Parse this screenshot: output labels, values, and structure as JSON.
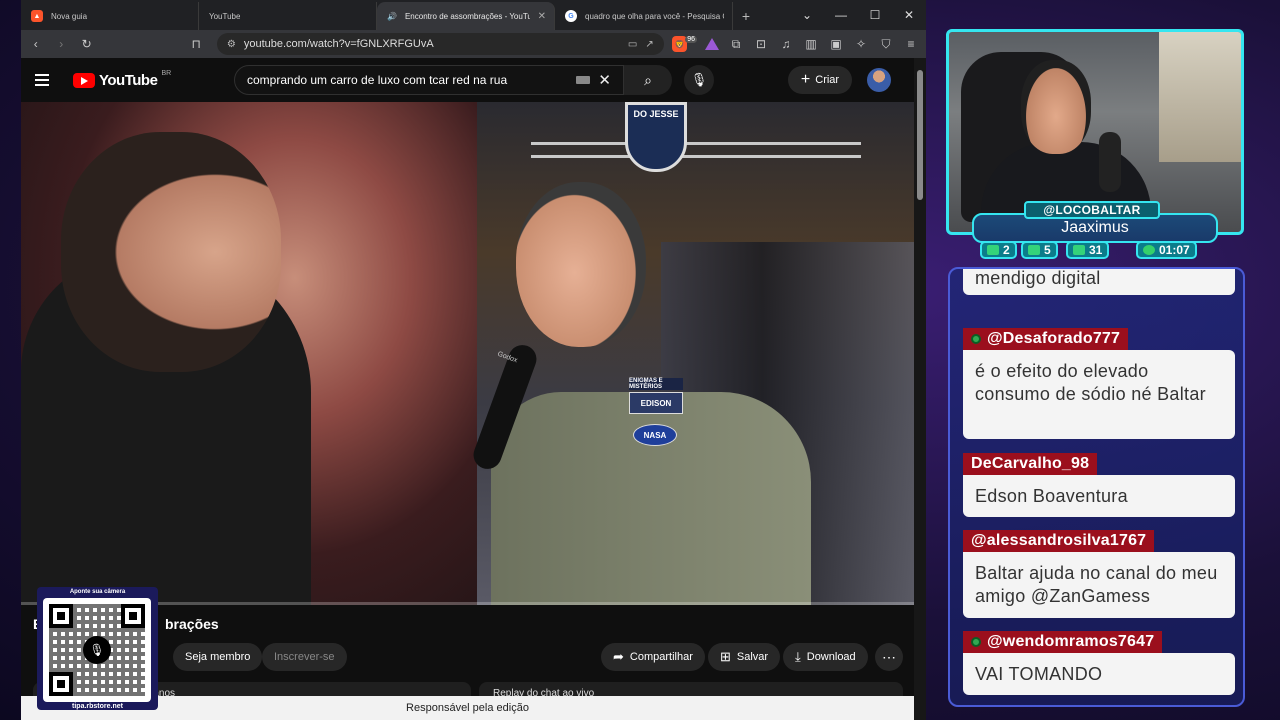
{
  "browser": {
    "tabs": [
      {
        "label": "Nova guia",
        "icon": "brave-icon"
      },
      {
        "label": "YouTube",
        "icon": "youtube-icon"
      },
      {
        "label": "Encontro de assombrações - YouTube",
        "icon": "youtube-icon",
        "active": true
      },
      {
        "label": "quadro que olha para você - Pesquisa Google",
        "icon": "google-icon"
      }
    ],
    "url": "youtube.com/watch?v=fGNLXRFGUvA",
    "shield_badge": "96"
  },
  "youtube": {
    "logo_text": "YouTube",
    "country_code": "BR",
    "search_query": "comprando um carro de luxo com tcar red na rua",
    "create_label": "Criar",
    "video_title": "Encontro de assombrações",
    "video_title_visible_suffix": "brações",
    "video_title_prefix": "E",
    "video_overlays": {
      "booth_sign": "DO JESSE",
      "patch_top": "ENIGMAS E MISTÉRIOS",
      "patch_name": "EDISON",
      "patch_nasa": "NASA",
      "mic_brand": "Godox"
    },
    "buttons": {
      "join": "Seja membro",
      "subscribe": "Inscrever-se",
      "share": "Compartilhar",
      "save": "Salvar",
      "download": "Download"
    },
    "cards": [
      "2 anos",
      "Replay do chat ao vivo"
    ],
    "banner": "Responsável pela edição",
    "progress": 0.0
  },
  "qr": {
    "top": "Aponte sua câmera",
    "bottom": "tipa.rbstore.net"
  },
  "stream": {
    "handle": "@LOCOBALTAR",
    "name": "Jaaximus",
    "stats": [
      {
        "icon": "chat-icon",
        "value": "2"
      },
      {
        "icon": "youtube-icon",
        "value": "5"
      },
      {
        "icon": "twitch-icon",
        "value": "31"
      },
      {
        "icon": "whatsapp-icon",
        "value": "01:07"
      }
    ]
  },
  "chat": [
    {
      "user": "",
      "text": "mendigo digital"
    },
    {
      "user": "@Desaforado777",
      "text": "é o efeito do elevado consumo de sódio né Baltar"
    },
    {
      "user": "DeCarvalho_98",
      "text": "Edson Boaventura"
    },
    {
      "user": "@alessandrosilva1767",
      "text": "Baltar ajuda no canal do meu amigo @ZanGamess"
    },
    {
      "user": "@wendomramos7647",
      "text": "VAI TOMANDO"
    }
  ],
  "colors": {
    "accent_cyan": "#35e6f0",
    "chat_user_bg": "#9b0f1d",
    "yt_red": "#ff0000"
  }
}
